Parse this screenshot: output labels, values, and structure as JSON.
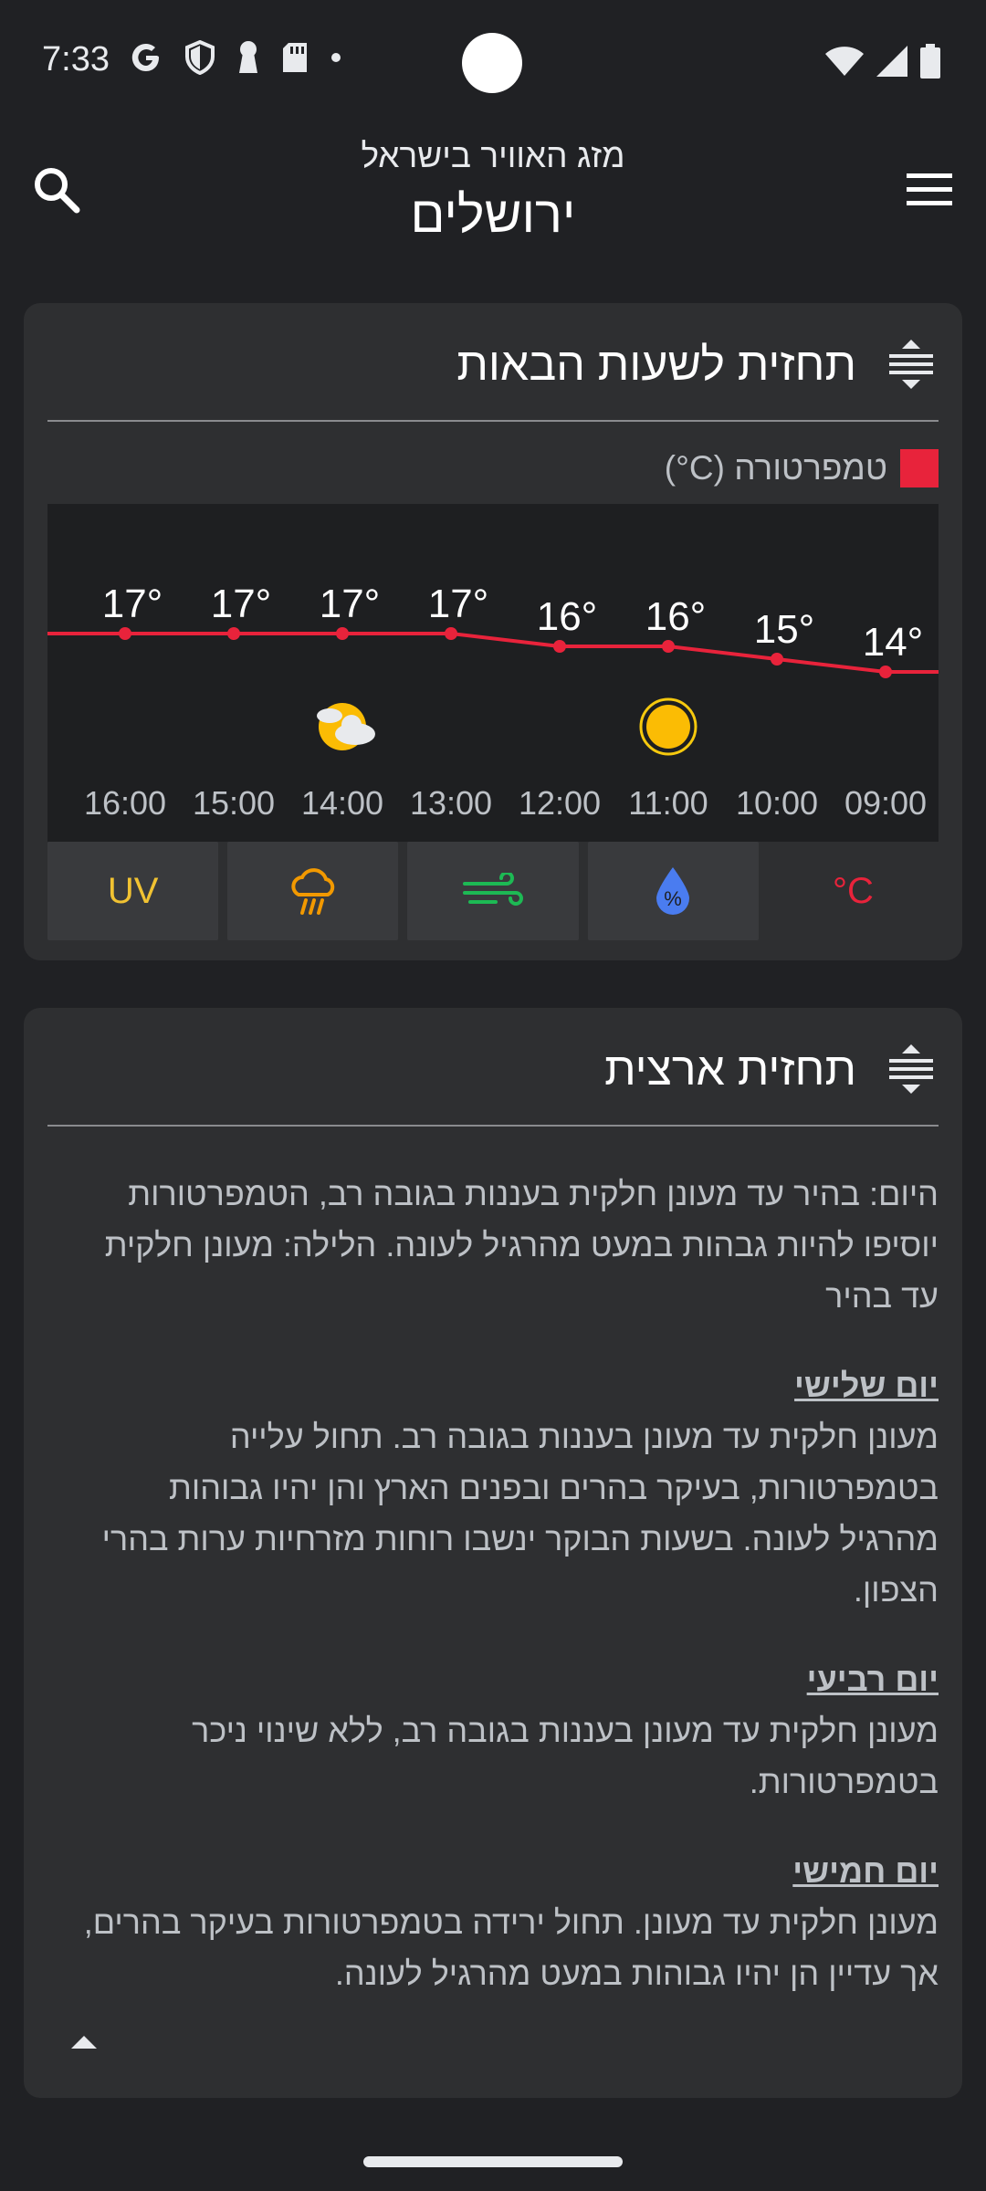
{
  "status_bar": {
    "time": "7:33"
  },
  "app_bar": {
    "subtitle": "מזג האוויר בישראל",
    "title": "ירושלים"
  },
  "hourly_card": {
    "title": "תחזית לשעות הבאות",
    "legend_label": "טמפרטורה (C°)",
    "tabs": [
      "°C",
      "%",
      "wind",
      "rain",
      "UV"
    ],
    "uv_label": "UV",
    "celsius_label": "°C",
    "colors": {
      "temp_line": "#e8233b",
      "uv": "#f1c232",
      "rain": "#f29900",
      "wind": "#1db954",
      "humidity": "#4a7cf0"
    }
  },
  "chart_data": {
    "type": "line",
    "title": "",
    "xlabel": "",
    "ylabel": "",
    "x": [
      "09:00",
      "10:00",
      "11:00",
      "12:00",
      "13:00",
      "14:00",
      "15:00",
      "16:00"
    ],
    "series": [
      {
        "name": "טמפרטורה (C°)",
        "values": [
          14,
          15,
          16,
          16,
          17,
          17,
          17,
          17
        ]
      }
    ],
    "value_labels": [
      "14°",
      "15°",
      "16°",
      "16°",
      "17°",
      "17°",
      "17°",
      "17°"
    ],
    "weather_icons": {
      "11:00": "sun-icon",
      "14:00": "partly-cloudy-icon"
    },
    "x_direction": "right-to-left",
    "legend": "top-right"
  },
  "national_card": {
    "title": "תחזית ארצית",
    "today": "היום: בהיר עד מעונן חלקית בעננות בגובה רב, הטמפרטורות יוסיפו להיות גבהות במעט מהרגיל לעונה. הלילה: מעונן חלקית עד בהיר",
    "days": [
      {
        "title": "יום שלישי",
        "text": "מעונן חלקית עד מעונן בעננות בגובה רב. תחול עלייה בטמפרטורות, בעיקר בהרים ובפנים הארץ והן יהיו גבוהות מהרגיל לעונה. בשעות הבוקר ינשבו רוחות מזרחיות ערות בהרי הצפון."
      },
      {
        "title": "יום רביעי",
        "text": "מעונן חלקית עד מעונן בעננות בגובה רב, ללא שינוי ניכר בטמפרטורות."
      },
      {
        "title": "יום חמישי",
        "text": "מעונן חלקית עד מעונן. תחול ירידה בטמפרטורות בעיקר בהרים, אך עדיין הן יהיו גבוהות במעט מהרגיל לעונה."
      }
    ]
  }
}
